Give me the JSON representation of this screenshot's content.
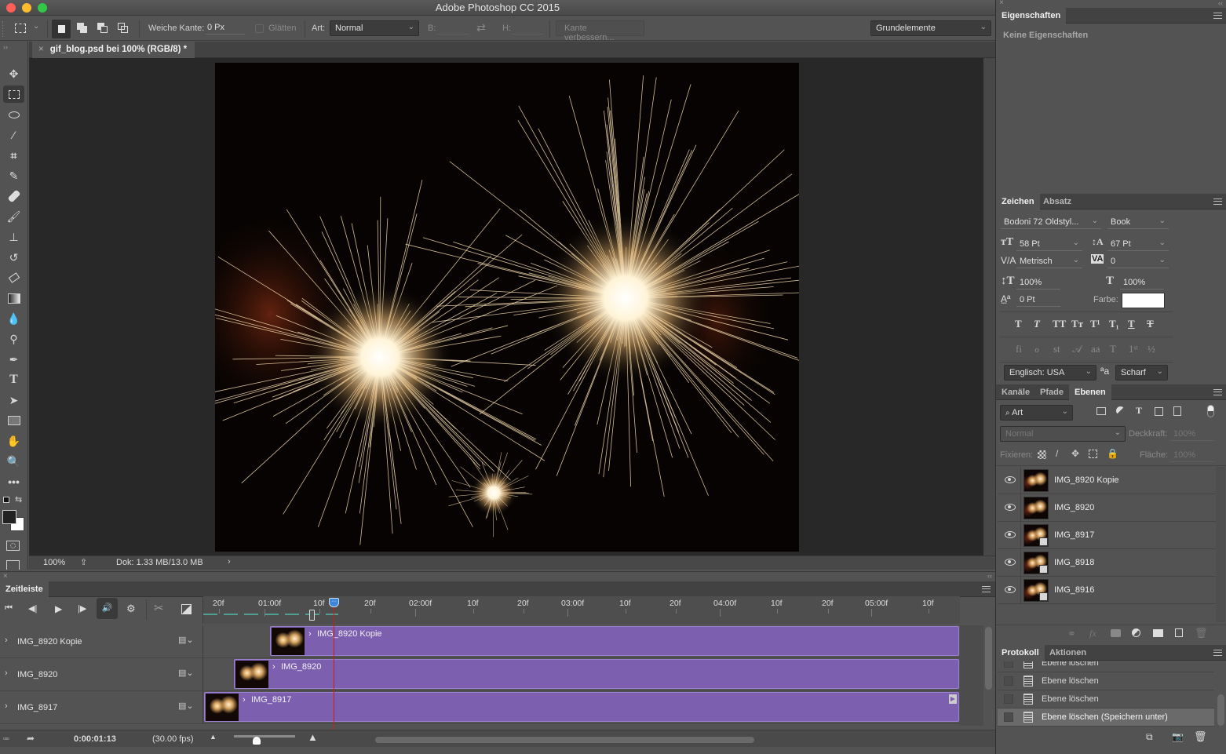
{
  "window": {
    "title": "Adobe Photoshop CC 2015",
    "traffic_lights": {
      "close": "#fc5f57",
      "minimize": "#fdbc2e",
      "zoom": "#33c748"
    }
  },
  "options_bar": {
    "feather_label": "Weiche Kante:",
    "feather_value": "0 Px",
    "antialias_label": "Glätten",
    "style_label": "Art:",
    "style_value": "Normal",
    "width_label": "B:",
    "height_label": "H:",
    "refine_edge_button": "Kante verbessern...",
    "workspace_value": "Grundelemente"
  },
  "document": {
    "tab_title": "gif_blog.psd bei 100% (RGB/8) *",
    "zoom": "100%",
    "doc_size": "Dok: 1.33 MB/13.0 MB"
  },
  "tools": [
    "move",
    "rectangular-marquee",
    "lasso",
    "quick-selection",
    "crop",
    "eyedropper",
    "healing-brush",
    "brush",
    "clone-stamp",
    "history-brush",
    "eraser",
    "gradient",
    "blur",
    "dodge",
    "pen",
    "type",
    "path-selection",
    "rectangle",
    "hand",
    "zoom",
    "more-tools"
  ],
  "timeline": {
    "panel_title": "Zeitleiste",
    "ticks": [
      "20f",
      "01:00f",
      "10f",
      "20f",
      "02:00f",
      "10f",
      "20f",
      "03:00f",
      "10f",
      "20f",
      "04:00f",
      "10f",
      "20f",
      "05:00f",
      "10f"
    ],
    "tracks": [
      {
        "name": "IMG_8920 Kopie",
        "clip_label": "IMG_8920 Kopie"
      },
      {
        "name": "IMG_8920",
        "clip_label": "IMG_8920"
      },
      {
        "name": "IMG_8917",
        "clip_label": "IMG_8917"
      }
    ],
    "current_time": "0:00:01:13",
    "fps": "(30.00 fps)",
    "clip_color": "#7d5fb0",
    "playhead_color": "#d0191c"
  },
  "properties": {
    "tab": "Eigenschaften",
    "empty_text": "Keine Eigenschaften"
  },
  "character": {
    "tabs": [
      "Zeichen",
      "Absatz"
    ],
    "font_family": "Bodoni 72 Oldstyl...",
    "font_style": "Book",
    "font_size": "58 Pt",
    "leading": "67 Pt",
    "kerning": "Metrisch",
    "tracking": "0",
    "vertical_scale": "100%",
    "horizontal_scale": "100%",
    "baseline_shift": "0 Pt",
    "color_label": "Farbe:",
    "color_value": "#ffffff",
    "language": "Englisch: USA",
    "antialias": "Scharf"
  },
  "layers": {
    "tabs": [
      "Kanäle",
      "Pfade",
      "Ebenen"
    ],
    "filter_kind": "Art",
    "blend_mode": "Normal",
    "opacity_label": "Deckkraft:",
    "opacity_value": "100%",
    "lock_label": "Fixieren:",
    "fill_label": "Fläche:",
    "fill_value": "100%",
    "items": [
      {
        "name": "IMG_8920 Kopie",
        "smart": false
      },
      {
        "name": "IMG_8920",
        "smart": false
      },
      {
        "name": "IMG_8917",
        "smart": true
      },
      {
        "name": "IMG_8918",
        "smart": true
      },
      {
        "name": "IMG_8916",
        "smart": true
      }
    ]
  },
  "history": {
    "tabs": [
      "Protokoll",
      "Aktionen"
    ],
    "items": [
      "Ebene löschen",
      "Ebene löschen",
      "Ebene löschen",
      "Ebene löschen (Speichern unter)"
    ]
  }
}
